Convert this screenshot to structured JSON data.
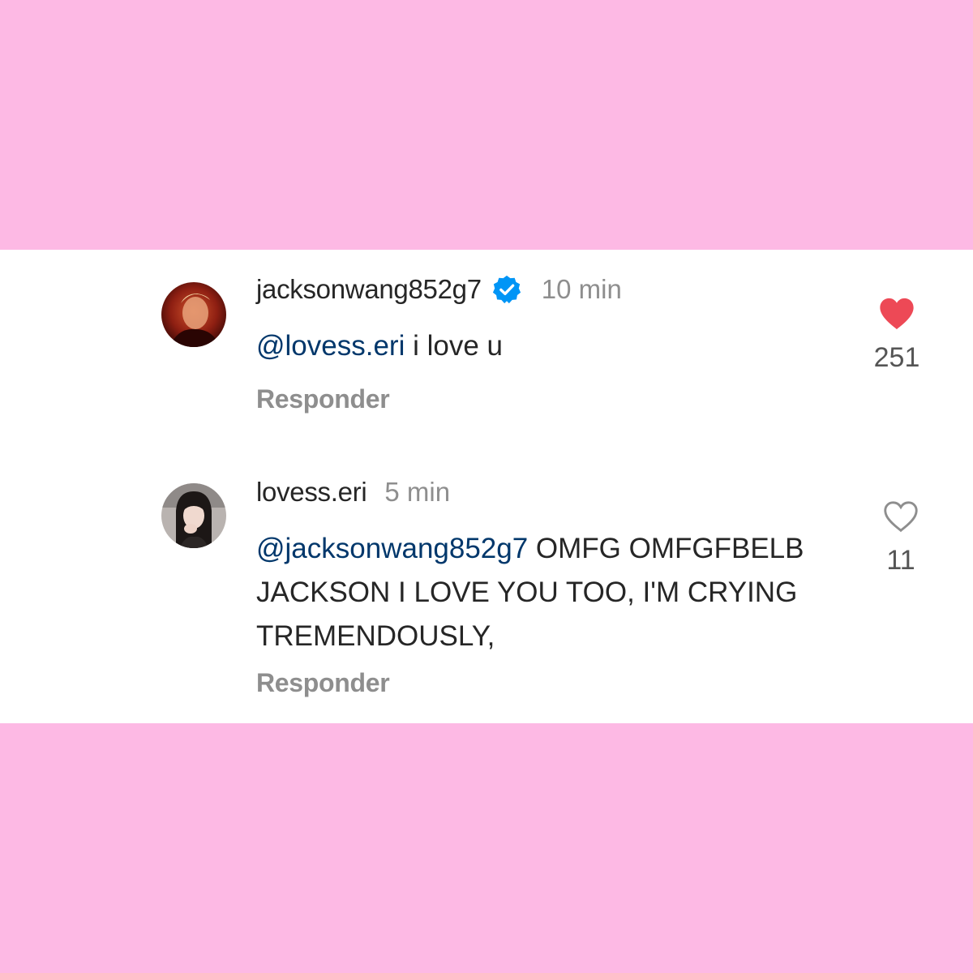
{
  "colors": {
    "page_background": "#fdb9e4",
    "panel_background": "#ffffff",
    "username": "#262626",
    "mention": "#00376b",
    "muted": "#8e8e8e",
    "verified_badge": "#0095f6",
    "heart_filled": "#ed4956"
  },
  "comments": [
    {
      "username": "jacksonwang852g7",
      "verified": true,
      "time": "10 min",
      "mention": "@lovess.eri",
      "text": " i love u",
      "reply_label": "Responder",
      "likes": "251",
      "liked": true,
      "icons": {
        "avatar": "avatar-icon",
        "badge": "verified-badge-icon",
        "like": "heart-filled-icon"
      }
    },
    {
      "username": "lovess.eri",
      "verified": false,
      "time": "5 min",
      "mention": "@jacksonwang852g7",
      "text": " OMFG OMFGFBELB JACKSON I LOVE YOU TOO, I'M CRYING TREMENDOUSLY,",
      "reply_label": "Responder",
      "likes": "11",
      "liked": false,
      "icons": {
        "avatar": "avatar-icon",
        "like": "heart-outline-icon"
      }
    }
  ]
}
